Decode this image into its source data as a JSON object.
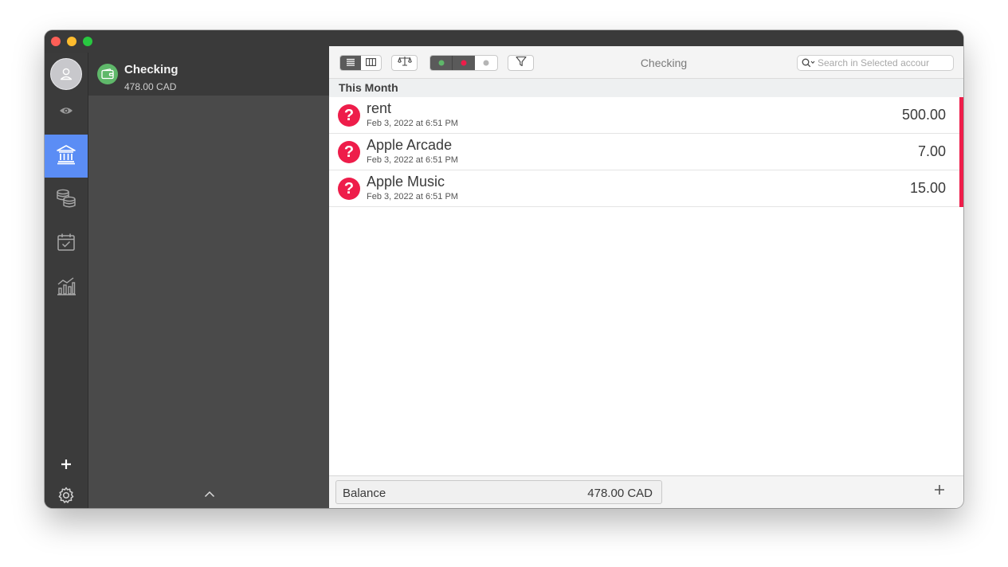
{
  "window": {
    "title": "Checking"
  },
  "sidebar": {
    "items": [
      {
        "name": "profile",
        "icon": "user-avatar-icon"
      },
      {
        "name": "watch",
        "icon": "eye-icon"
      },
      {
        "name": "accounts",
        "icon": "bank-icon",
        "active": true
      },
      {
        "name": "budgets",
        "icon": "coins-icon"
      },
      {
        "name": "scheduled",
        "icon": "calendar-check-icon"
      },
      {
        "name": "reports",
        "icon": "chart-icon"
      }
    ],
    "add_icon": "plus-icon",
    "settings_icon": "gear-icon"
  },
  "accounts": {
    "items": [
      {
        "name": "Checking",
        "balance": "478.00 CAD",
        "icon": "wallet-icon",
        "color": "#5fb86a"
      }
    ]
  },
  "toolbar": {
    "view_modes": [
      "list-view-icon",
      "column-view-icon"
    ],
    "reconcile_icon": "scales-icon",
    "status_filters": [
      "cleared-green-dot",
      "uncleared-red-dot",
      "all-gray-dot"
    ],
    "filter_icon": "funnel-icon",
    "search": {
      "placeholder": "Search in Selected accour",
      "value": ""
    }
  },
  "transactions": {
    "section_title": "This Month",
    "items": [
      {
        "name": "rent",
        "date": "Feb 3, 2022 at 6:51 PM",
        "amount": "500.00",
        "icon_symbol": "?"
      },
      {
        "name": "Apple Arcade",
        "date": "Feb 3, 2022 at 6:51 PM",
        "amount": "7.00",
        "icon_symbol": "?"
      },
      {
        "name": "Apple Music",
        "date": "Feb 3, 2022 at 6:51 PM",
        "amount": "15.00",
        "icon_symbol": "?"
      }
    ]
  },
  "footer": {
    "balance_label": "Balance",
    "balance_value": "478.00 CAD"
  },
  "colors": {
    "accent": "#5b8df5",
    "expense": "#ee1d4a",
    "account": "#5fb86a"
  }
}
